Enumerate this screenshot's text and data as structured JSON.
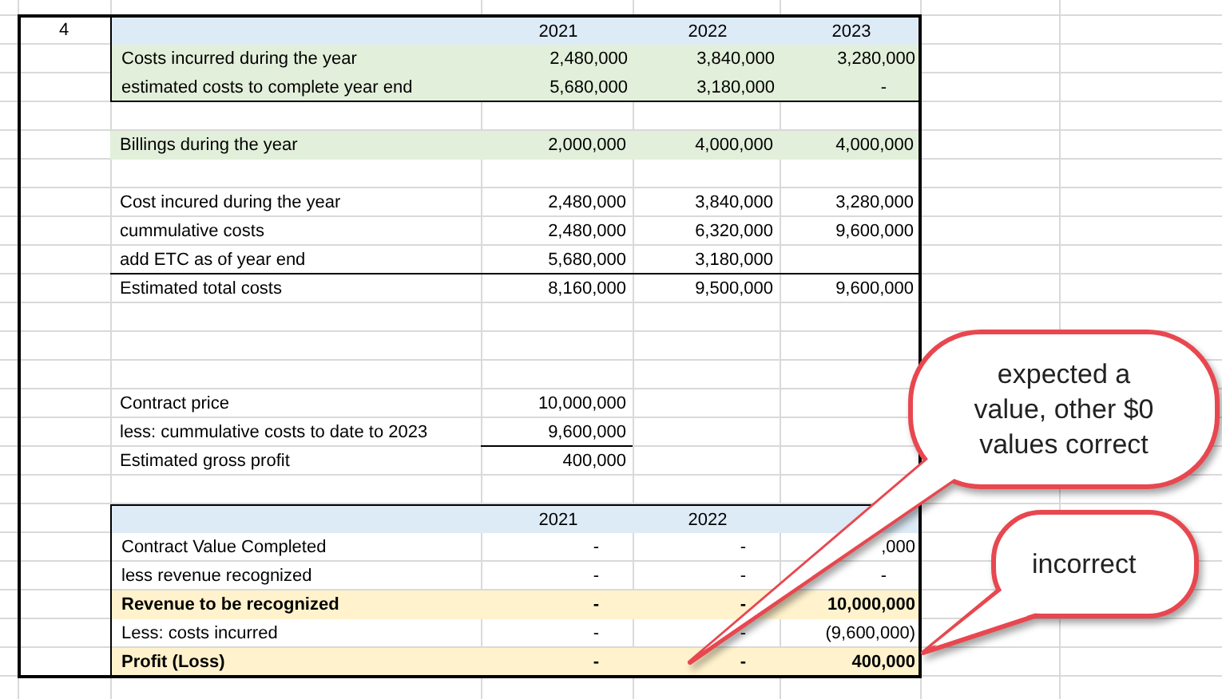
{
  "rows": [
    {
      "kind": "header",
      "row_label": "4",
      "boxed": true,
      "color": "#ddebf7",
      "cells": [
        "",
        "2021",
        "2022",
        "2023"
      ]
    },
    {
      "kind": "data",
      "boxed": true,
      "color": "#e2efda",
      "cells": [
        "Costs incurred during the year",
        "2,480,000",
        "3,840,000",
        "3,280,000"
      ]
    },
    {
      "kind": "data",
      "boxed": true,
      "color": "#e2efda",
      "cells": [
        "estimated costs to complete year end",
        "5,680,000",
        "3,180,000",
        {
          "kind": "zero",
          "text": "-"
        }
      ]
    },
    {
      "kind": "blank"
    },
    {
      "kind": "data",
      "color": "#e2efda",
      "cells": [
        "Billings during the year",
        "2,000,000",
        "4,000,000",
        "4,000,000"
      ]
    },
    {
      "kind": "blank"
    },
    {
      "kind": "data",
      "cells": [
        "Cost incured during the year",
        "2,480,000",
        "3,840,000",
        "3,280,000"
      ]
    },
    {
      "kind": "data",
      "cells": [
        "cummulative costs",
        "2,480,000",
        "6,320,000",
        "9,600,000"
      ]
    },
    {
      "kind": "data",
      "rule_below": true,
      "cells": [
        "add ETC as of year end",
        "5,680,000",
        "3,180,000",
        ""
      ]
    },
    {
      "kind": "data",
      "cells": [
        "Estimated total costs",
        "8,160,000",
        "9,500,000",
        "9,600,000"
      ]
    },
    {
      "kind": "blank"
    },
    {
      "kind": "blank"
    },
    {
      "kind": "blank"
    },
    {
      "kind": "data",
      "cells": [
        "Contract price",
        "10,000,000",
        "",
        ""
      ]
    },
    {
      "kind": "data",
      "cells": [
        "less: cummulative costs to date to 2023",
        {
          "kind": "underlined",
          "text": "9,600,000"
        },
        "",
        ""
      ]
    },
    {
      "kind": "data",
      "cells": [
        "Estimated gross profit",
        "400,000",
        "",
        ""
      ]
    },
    {
      "kind": "blank"
    },
    {
      "kind": "header",
      "boxed": true,
      "color": "#ddebf7",
      "cells": [
        "",
        "2021",
        "2022",
        ""
      ]
    },
    {
      "kind": "data",
      "boxed": true,
      "cells": [
        "Contract Value Completed",
        {
          "kind": "zero",
          "text": "-"
        },
        {
          "kind": "zero",
          "text": "-"
        },
        ",000"
      ]
    },
    {
      "kind": "data",
      "boxed": true,
      "cells": [
        "less revenue recognized",
        {
          "kind": "zero",
          "text": "-"
        },
        {
          "kind": "zero",
          "text": "-"
        },
        {
          "kind": "zero",
          "text": "-"
        }
      ]
    },
    {
      "kind": "data",
      "boxed": true,
      "bold": true,
      "color": "#fff2cc",
      "cells": [
        "Revenue to be recognized",
        {
          "kind": "zero",
          "text": "-"
        },
        {
          "kind": "zero",
          "text": "-"
        },
        "10,000,000"
      ]
    },
    {
      "kind": "data",
      "boxed": true,
      "cells": [
        "Less: costs incurred",
        {
          "kind": "zero",
          "text": "-"
        },
        {
          "kind": "zero",
          "text": "-"
        },
        "(9,600,000)"
      ]
    },
    {
      "kind": "data",
      "boxed": true,
      "bold": true,
      "color": "#fff2cc",
      "cells": [
        "Profit (Loss)",
        {
          "kind": "zero",
          "text": "-"
        },
        {
          "kind": "zero",
          "text": "-"
        },
        "400,000"
      ]
    }
  ],
  "callouts": [
    {
      "text": "expected a value, other $0 values correct"
    },
    {
      "text": "incorrect"
    }
  ]
}
